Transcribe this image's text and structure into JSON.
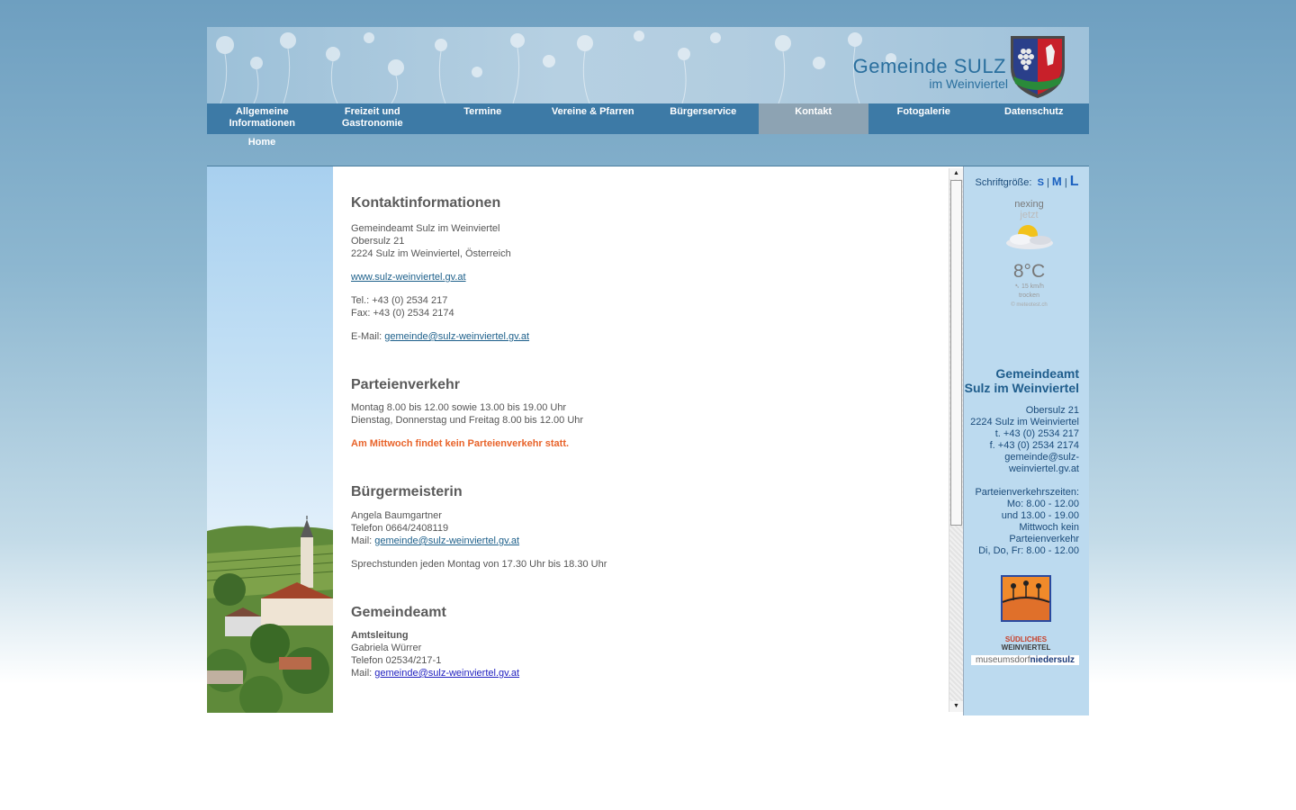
{
  "header": {
    "title_line1": "Gemeinde SULZ",
    "title_line2": "im Weinviertel"
  },
  "nav": {
    "items": [
      {
        "label_line1": "Allgemeine",
        "label_line2": "Informationen"
      },
      {
        "label_line1": "Freizeit und",
        "label_line2": "Gastronomie"
      },
      {
        "label_line1": "Termine",
        "label_line2": ""
      },
      {
        "label_line1": "Vereine & Pfarren",
        "label_line2": ""
      },
      {
        "label_line1": "Bürgerservice",
        "label_line2": ""
      },
      {
        "label_line1": "Kontakt",
        "label_line2": ""
      },
      {
        "label_line1": "Fotogalerie",
        "label_line2": ""
      },
      {
        "label_line1": "Datenschutz",
        "label_line2": ""
      }
    ],
    "active_index": 5,
    "sub_item": "Home"
  },
  "content": {
    "kontakt": {
      "heading": "Kontaktinformationen",
      "line1": "Gemeindeamt Sulz im Weinviertel",
      "line2": "Obersulz 21",
      "line3": "2224 Sulz im Weinviertel, Österreich",
      "website": "www.sulz-weinviertel.gv.at",
      "tel": "Tel.: +43 (0) 2534 217",
      "fax": "Fax: +43 (0) 2534 2174",
      "email_label": "E-Mail: ",
      "email": "gemeinde@sulz-weinviertel.gv.at"
    },
    "parteienverkehr": {
      "heading": "Parteienverkehr",
      "line1": "Montag 8.00 bis 12.00 sowie 13.00 bis 19.00 Uhr",
      "line2": "Dienstag, Donnerstag und  Freitag 8.00 bis 12.00 Uhr",
      "notice": "Am Mittwoch findet kein Parteienverkehr statt."
    },
    "buergermeisterin": {
      "heading": "Bürgermeisterin",
      "name": "Angela Baumgartner",
      "phone": "Telefon 0664/2408119",
      "mail_label": "Mail: ",
      "mail": "gemeinde@sulz-weinviertel.gv.at",
      "hours": "Sprechstunden jeden Montag von 17.30 Uhr bis 18.30 Uhr"
    },
    "gemeindeamt": {
      "heading": "Gemeindeamt",
      "role": "Amtsleitung",
      "name": "Gabriela Würrer",
      "phone": "Telefon 02534/217-1",
      "mail_label": "Mail: ",
      "mail": "gemeinde@sulz-weinviertel.gv.at"
    }
  },
  "sidebar": {
    "fontsize_label": "Schriftgröße:",
    "size_s": "S",
    "size_m": "M",
    "size_l": "L",
    "separator": "|",
    "weather": {
      "place": "nexing",
      "time": "jetzt",
      "temp": "8°C",
      "wind": "15 km/h",
      "condition": "trocken",
      "credit": "© meteotest.ch"
    },
    "address": {
      "name_line1": "Gemeindeamt",
      "name_line2": "Sulz im Weinviertel",
      "street": "Obersulz 21",
      "city": "2224 Sulz im Weinviertel",
      "tel": "t. +43 (0) 2534 217",
      "fax": "f. +43 (0) 2534 2174",
      "email_line1": "gemeinde@sulz-",
      "email_line2": "weinviertel.gv.at",
      "hours_label": "Parteienverkehrszeiten:",
      "hours1": "Mo: 8.00 - 12.00",
      "hours2": "und 13.00 - 19.00",
      "hours3": "Mittwoch kein",
      "hours4": "Parteienverkehr",
      "hours5": "Di, Do, Fr: 8.00 - 12.00"
    },
    "logo1_line1": "SÜDLICHES",
    "logo1_line2": "WEINVIERTEL",
    "logo2_part1": "museumsdorf",
    "logo2_part2": "niedersulz"
  },
  "colors": {
    "nav_bg": "#3d7aa6",
    "nav_active": "#8da3b3",
    "warning": "#e8632a",
    "link": "#1c5f8a"
  }
}
